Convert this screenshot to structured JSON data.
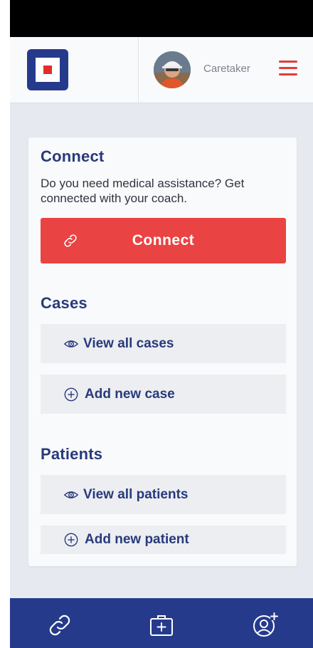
{
  "header": {
    "user_role": "Caretaker"
  },
  "connect": {
    "title": "Connect",
    "description": "Do you need medical assistance? Get connected with your coach.",
    "button_label": "Connect"
  },
  "cases": {
    "title": "Cases",
    "view_all": "View all cases",
    "add_new": "Add new case"
  },
  "patients": {
    "title": "Patients",
    "view_all": "View all patients",
    "add_new": "Add new patient"
  },
  "colors": {
    "brand_navy": "#263a8c",
    "accent_red": "#ea4343",
    "heading_blue": "#283a7b",
    "background": "#e6e9ef"
  },
  "icons": {
    "logo": "square-logo",
    "menu": "hamburger-menu-icon",
    "connect": "link-icon",
    "view": "eye-icon",
    "add": "plus-circle-icon",
    "nav_connect": "link-icon",
    "nav_cases": "medical-kit-icon",
    "nav_patients": "add-user-icon"
  }
}
